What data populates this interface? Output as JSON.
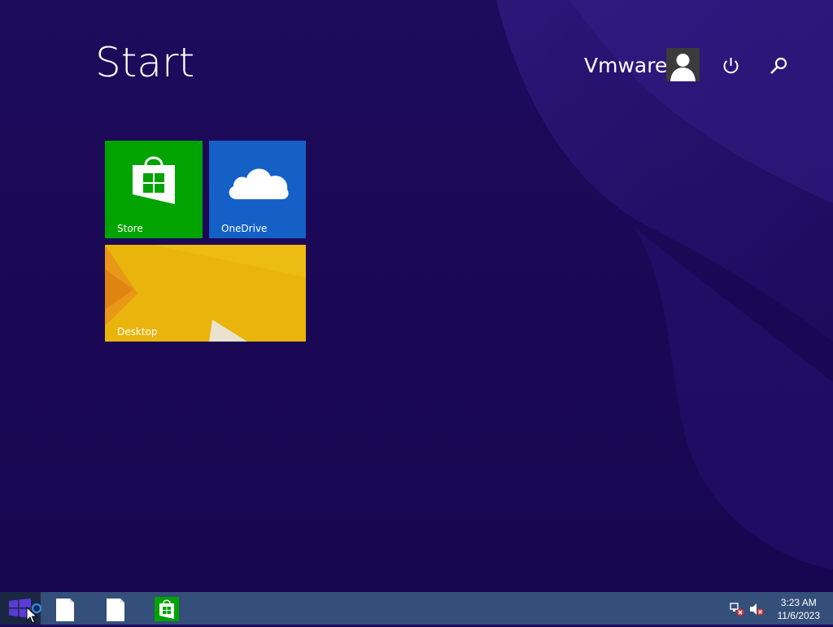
{
  "start": {
    "title": "Start"
  },
  "user": {
    "name": "Vmware",
    "avatar_icon": "user-silhouette-icon"
  },
  "header_buttons": {
    "power_icon": "power-icon",
    "search_icon": "search-icon"
  },
  "tiles": [
    {
      "label": "Store",
      "icon": "store-bag-icon",
      "color": "#00a300"
    },
    {
      "label": "OneDrive",
      "icon": "cloud-icon",
      "color": "#1460c7"
    },
    {
      "label": "Desktop",
      "icon": "desktop-wallpaper",
      "color": "#e9b40b"
    }
  ],
  "taskbar": {
    "start_icon": "windows-logo-icon",
    "pinned": [
      {
        "name": "document-1",
        "icon": "blank-document-icon"
      },
      {
        "name": "document-2",
        "icon": "blank-document-icon"
      },
      {
        "name": "store",
        "icon": "store-bag-icon"
      }
    ],
    "tray": {
      "network_icon": "network-disconnected-icon",
      "volume_icon": "volume-muted-icon",
      "time": "3:23 AM",
      "date": "11/6/2023"
    }
  }
}
